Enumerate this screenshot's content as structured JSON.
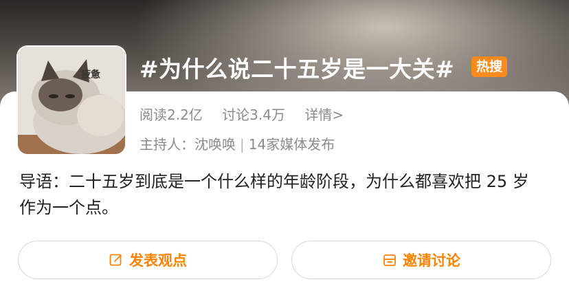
{
  "topic": {
    "title": "#为什么说二十五岁是一大关#",
    "badge": "热搜",
    "cover_caption": "疲惫",
    "cover_icon": "cat-photo"
  },
  "stats": {
    "reads": "阅读2.2亿",
    "discussions": "讨论3.4万",
    "detail_link": "详情>"
  },
  "host": {
    "label": "主持人：沈唤唤",
    "media": "14家媒体发布",
    "separator": "|"
  },
  "intro": {
    "text": "导语：二十五岁到底是一个什么样的年龄阶段，为什么都喜欢把 25 岁作为一个点。"
  },
  "actions": {
    "post_label": "发表观点",
    "post_icon": "edit-icon",
    "invite_label": "邀请讨论",
    "invite_icon": "invite-icon"
  },
  "colors": {
    "accent": "#ff8200",
    "badge": "#ff8a1e",
    "meta_text": "#8b8b8b"
  }
}
